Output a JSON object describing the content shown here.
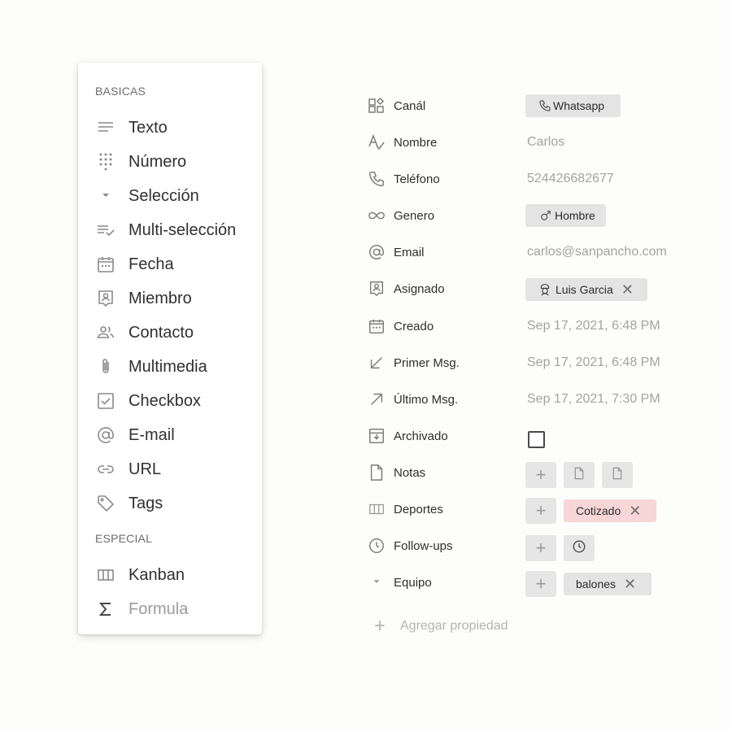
{
  "menu": {
    "section_basic": "BASICAS",
    "section_special": "ESPECIAL",
    "basic_items": [
      {
        "label": "Texto",
        "icon": "lines-icon"
      },
      {
        "label": "Número",
        "icon": "dialpad-icon"
      },
      {
        "label": "Selección",
        "icon": "caret-down-icon"
      },
      {
        "label": "Multi-selección",
        "icon": "checklist-icon"
      },
      {
        "label": "Fecha",
        "icon": "calendar-icon"
      },
      {
        "label": "Miembro",
        "icon": "member-badge-icon"
      },
      {
        "label": "Contacto",
        "icon": "people-icon"
      },
      {
        "label": "Multimedia",
        "icon": "paperclip-icon"
      },
      {
        "label": "Checkbox",
        "icon": "checkbox-icon"
      },
      {
        "label": "E-mail",
        "icon": "at-icon"
      },
      {
        "label": "URL",
        "icon": "link-icon"
      },
      {
        "label": "Tags",
        "icon": "tag-icon"
      }
    ],
    "special_items": [
      {
        "label": "Kanban",
        "icon": "kanban-icon"
      },
      {
        "label": "Formula",
        "icon": "sigma-icon"
      }
    ]
  },
  "properties": {
    "canal": {
      "name": "Canál",
      "value": "Whatsapp"
    },
    "nombre": {
      "name": "Nombre",
      "value": "Carlos"
    },
    "telefono": {
      "name": "Teléfono",
      "value": "524426682677"
    },
    "genero": {
      "name": "Genero",
      "value": "Hombre"
    },
    "email": {
      "name": "Email",
      "value": "carlos@sanpancho.com"
    },
    "asignado": {
      "name": "Asignado",
      "value": "Luis Garcia"
    },
    "creado": {
      "name": "Creado",
      "value": "Sep 17, 2021, 6:48 PM"
    },
    "primer": {
      "name": "Primer Msg.",
      "value": "Sep 17, 2021, 6:48 PM"
    },
    "ultimo": {
      "name": "Último Msg.",
      "value": "Sep 17, 2021, 7:30 PM"
    },
    "archivado": {
      "name": "Archivado",
      "checked": false
    },
    "notas": {
      "name": "Notas"
    },
    "deportes": {
      "name": "Deportes",
      "tag": "Cotizado",
      "tag_color": "#f6d6d6"
    },
    "followups": {
      "name": "Follow-ups"
    },
    "equipo": {
      "name": "Equipo",
      "tag": "balones"
    }
  },
  "add_property": {
    "plus": "+",
    "label": "Agregar propiedad"
  },
  "glyphs": {
    "remove": "✕",
    "add": "+"
  }
}
